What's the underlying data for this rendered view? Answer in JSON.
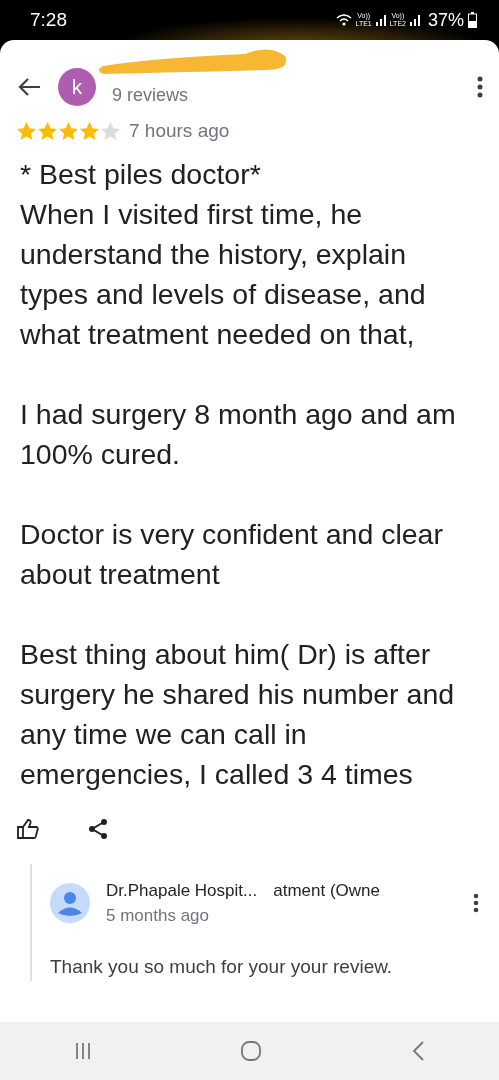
{
  "status_bar": {
    "time": "7:28",
    "sim_labels": [
      {
        "top": "Vo))",
        "bottom": "LTE1"
      },
      {
        "top": "Vo))",
        "bottom": "LTE2"
      }
    ],
    "battery": "37%"
  },
  "reviewer": {
    "initial": "k",
    "reviews": "9 reviews"
  },
  "review": {
    "stars": 4,
    "time": "7 hours ago",
    "paragraphs": [
      "* Best piles doctor*\nWhen I visited first time, he understand the history, explain types and levels of disease, and what treatment needed on that,",
      "I had surgery 8 month ago and am 100% cured.",
      "Doctor is very confident and clear about treatment",
      "Best thing about him( Dr) is after surgery he shared his number and any time we can call in emergencies, I called 3 4 times"
    ]
  },
  "owner_reply": {
    "name": "Dr.Phapale Hospit...",
    "name_rest": "atment (Owne",
    "time": "5 months ago",
    "text": "Thank you so much for your your review."
  }
}
